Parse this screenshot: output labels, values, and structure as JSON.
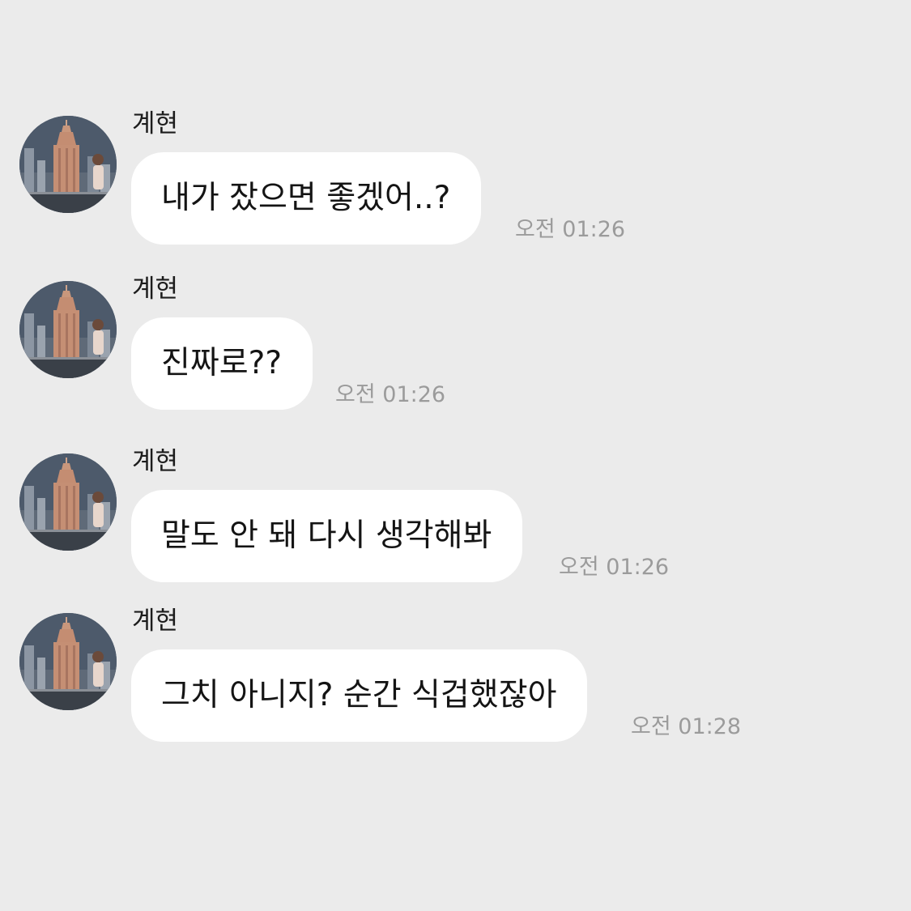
{
  "messages": [
    {
      "sender": "계현",
      "text": "내가 잤으면 좋겠어..?",
      "time": "오전 01:26"
    },
    {
      "sender": "계현",
      "text": "진짜로??",
      "time": "오전 01:26"
    },
    {
      "sender": "계현",
      "text": "말도 안 돼 다시 생각해봐",
      "time": "오전 01:26"
    },
    {
      "sender": "계현",
      "text": "그치 아니지? 순간 식겁했잖아",
      "time": "오전 01:28"
    }
  ],
  "colors": {
    "background": "#ebebeb",
    "bubble": "#ffffff",
    "time_text": "#9b9b9b"
  },
  "icons": {
    "avatar": "profile-photo"
  }
}
